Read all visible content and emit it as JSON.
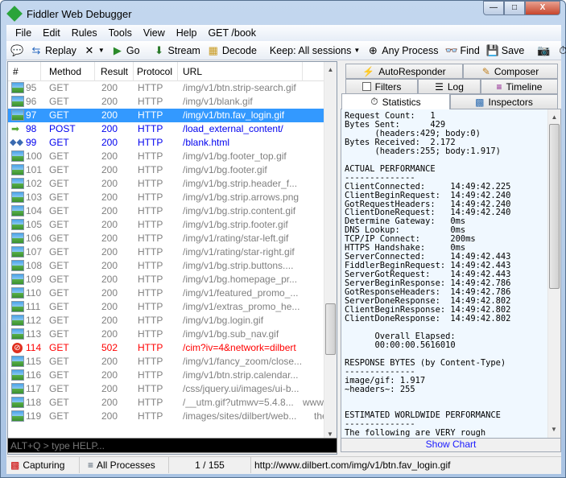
{
  "window": {
    "title": "Fiddler Web Debugger",
    "min": "—",
    "max": "□",
    "close": "X"
  },
  "menu": [
    "File",
    "Edit",
    "Rules",
    "Tools",
    "View",
    "Help",
    "GET /book"
  ],
  "toolbar": {
    "replay": "Replay",
    "go": "Go",
    "stream": "Stream",
    "decode": "Decode",
    "keep": "Keep: All sessions",
    "process": "Any Process",
    "find": "Find",
    "save": "Save"
  },
  "columns": [
    "#",
    "Method",
    "Result",
    "Protocol",
    "URL"
  ],
  "sessions": [
    {
      "id": "95",
      "method": "GET",
      "result": "200",
      "protocol": "HTTP",
      "url": "/img/v1/btn.strip-search.gif",
      "host": "",
      "type": "image"
    },
    {
      "id": "96",
      "method": "GET",
      "result": "200",
      "protocol": "HTTP",
      "url": "/img/v1/blank.gif",
      "host": "",
      "type": "image"
    },
    {
      "id": "97",
      "method": "GET",
      "result": "200",
      "protocol": "HTTP",
      "url": "/img/v1/btn.fav_login.gif",
      "host": "",
      "type": "image",
      "selected": true
    },
    {
      "id": "98",
      "method": "POST",
      "result": "200",
      "protocol": "HTTP",
      "url": "/load_external_content/",
      "host": "",
      "type": "post"
    },
    {
      "id": "99",
      "method": "GET",
      "result": "200",
      "protocol": "HTTP",
      "url": "/blank.html",
      "host": "",
      "type": "html"
    },
    {
      "id": "100",
      "method": "GET",
      "result": "200",
      "protocol": "HTTP",
      "url": "/img/v1/bg.footer_top.gif",
      "host": "",
      "type": "image"
    },
    {
      "id": "101",
      "method": "GET",
      "result": "200",
      "protocol": "HTTP",
      "url": "/img/v1/bg.footer.gif",
      "host": "",
      "type": "image"
    },
    {
      "id": "102",
      "method": "GET",
      "result": "200",
      "protocol": "HTTP",
      "url": "/img/v1/bg.strip.header_f...",
      "host": "",
      "type": "image"
    },
    {
      "id": "103",
      "method": "GET",
      "result": "200",
      "protocol": "HTTP",
      "url": "/img/v1/bg.strip.arrows.png",
      "host": "",
      "type": "image"
    },
    {
      "id": "104",
      "method": "GET",
      "result": "200",
      "protocol": "HTTP",
      "url": "/img/v1/bg.strip.content.gif",
      "host": "",
      "type": "image"
    },
    {
      "id": "105",
      "method": "GET",
      "result": "200",
      "protocol": "HTTP",
      "url": "/img/v1/bg.strip.footer.gif",
      "host": "",
      "type": "image"
    },
    {
      "id": "106",
      "method": "GET",
      "result": "200",
      "protocol": "HTTP",
      "url": "/img/v1/rating/star-left.gif",
      "host": "",
      "type": "image"
    },
    {
      "id": "107",
      "method": "GET",
      "result": "200",
      "protocol": "HTTP",
      "url": "/img/v1/rating/star-right.gif",
      "host": "",
      "type": "image"
    },
    {
      "id": "108",
      "method": "GET",
      "result": "200",
      "protocol": "HTTP",
      "url": "/img/v1/bg.strip.buttons....",
      "host": "",
      "type": "image"
    },
    {
      "id": "109",
      "method": "GET",
      "result": "200",
      "protocol": "HTTP",
      "url": "/img/v1/bg.homepage_pr...",
      "host": "",
      "type": "image"
    },
    {
      "id": "110",
      "method": "GET",
      "result": "200",
      "protocol": "HTTP",
      "url": "/img/v1/featured_promo_...",
      "host": "",
      "type": "image"
    },
    {
      "id": "111",
      "method": "GET",
      "result": "200",
      "protocol": "HTTP",
      "url": "/img/v1/extras_promo_he...",
      "host": "",
      "type": "image"
    },
    {
      "id": "112",
      "method": "GET",
      "result": "200",
      "protocol": "HTTP",
      "url": "/img/v1/bg.login.gif",
      "host": "",
      "type": "image"
    },
    {
      "id": "113",
      "method": "GET",
      "result": "200",
      "protocol": "HTTP",
      "url": "/img/v1/bg.sub_nav.gif",
      "host": "",
      "type": "image"
    },
    {
      "id": "114",
      "method": "GET",
      "result": "502",
      "protocol": "HTTP",
      "url": "/cim?iv=4&network=dilbert",
      "host": "",
      "type": "error"
    },
    {
      "id": "115",
      "method": "GET",
      "result": "200",
      "protocol": "HTTP",
      "url": "/img/v1/fancy_zoom/close...",
      "host": "",
      "type": "image"
    },
    {
      "id": "116",
      "method": "GET",
      "result": "200",
      "protocol": "HTTP",
      "url": "/img/v1/btn.strip.calendar...",
      "host": "",
      "type": "image"
    },
    {
      "id": "117",
      "method": "GET",
      "result": "200",
      "protocol": "HTTP",
      "url": "/css/jquery.ui/images/ui-b...",
      "host": "",
      "type": "image"
    },
    {
      "id": "118",
      "method": "GET",
      "result": "200",
      "protocol": "HTTP",
      "url": "/__utm.gif?utmwv=5.4.8...",
      "host": "www.",
      "type": "image"
    },
    {
      "id": "119",
      "method": "GET",
      "result": "200",
      "protocol": "HTTP",
      "url": "/images/sites/dilbert/web...",
      "host": "the",
      "type": "image"
    }
  ],
  "command_placeholder": "ALT+Q > type HELP...",
  "tabs": {
    "autoresponder": "AutoResponder",
    "composer": "Composer",
    "filters": "Filters",
    "log": "Log",
    "timeline": "Timeline",
    "statistics": "Statistics",
    "inspectors": "Inspectors"
  },
  "statistics_text": "Request Count:   1\nBytes Sent:      429\n      (headers:429; body:0)\nBytes Received:  2.172\n      (headers:255; body:1.917)\n\nACTUAL PERFORMANCE\n--------------\nClientConnected:     14:49:42.225\nClientBeginRequest:  14:49:42.240\nGotRequestHeaders:   14:49:42.240\nClientDoneRequest:   14:49:42.240\nDetermine Gateway:   0ms\nDNS Lookup:          0ms\nTCP/IP Connect:      200ms\nHTTPS Handshake:     0ms\nServerConnected:     14:49:42.443\nFiddlerBeginRequest: 14:49:42.443\nServerGotRequest:    14:49:42.443\nServerBeginResponse: 14:49:42.786\nGotResponseHeaders:  14:49:42.786\nServerDoneResponse:  14:49:42.802\nClientBeginResponse: 14:49:42.802\nClientDoneResponse:  14:49:42.802\n\n      Overall Elapsed:\n      00:00:00.5616010\n\nRESPONSE BYTES (by Content-Type)\n--------------\nimage/gif: 1.917\n~headers~: 255\n\n\nESTIMATED WORLDWIDE PERFORMANCE\n--------------\nThe following are VERY rough",
  "show_chart": "Show Chart",
  "status": {
    "capturing": "Capturing",
    "processes": "All Processes",
    "count": "1 / 155",
    "url": "http://www.dilbert.com/img/v1/btn.fav_login.gif"
  }
}
